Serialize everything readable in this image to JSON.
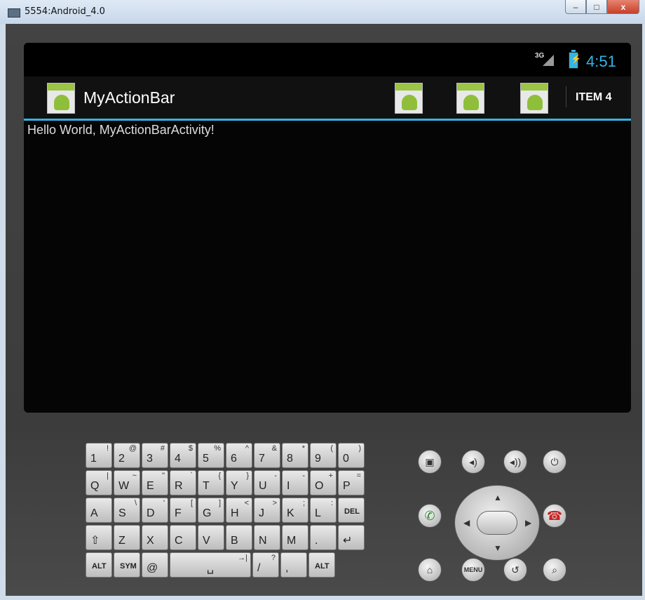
{
  "window": {
    "title": "5554:Android_4.0",
    "min": "–",
    "max": "□",
    "close": "x"
  },
  "status": {
    "network": "3G",
    "time": "4:51",
    "battery_glyph": "⚡"
  },
  "actionbar": {
    "title": "MyActionBar",
    "overflow_item": "ITEM 4"
  },
  "content": {
    "text": "Hello World, MyActionBarActivity!"
  },
  "keyboard": {
    "row1": [
      [
        "1",
        "!"
      ],
      [
        "2",
        "@"
      ],
      [
        "3",
        "#"
      ],
      [
        "4",
        "$"
      ],
      [
        "5",
        "%"
      ],
      [
        "6",
        "^"
      ],
      [
        "7",
        "&"
      ],
      [
        "8",
        "*"
      ],
      [
        "9",
        "("
      ],
      [
        "0",
        ")"
      ]
    ],
    "row2": [
      [
        "Q",
        "|"
      ],
      [
        "W",
        "~"
      ],
      [
        "E",
        "\""
      ],
      [
        "R",
        "`"
      ],
      [
        "T",
        "{"
      ],
      [
        "Y",
        "}"
      ],
      [
        "U",
        "-"
      ],
      [
        "I",
        "-"
      ],
      [
        "O",
        "+"
      ],
      [
        "P",
        "="
      ]
    ],
    "row3": [
      [
        "A",
        ""
      ],
      [
        "S",
        "\\"
      ],
      [
        "D",
        "'"
      ],
      [
        "F",
        "["
      ],
      [
        "G",
        "]"
      ],
      [
        "H",
        "<"
      ],
      [
        "J",
        ">"
      ],
      [
        "K",
        ";"
      ],
      [
        "L",
        ":"
      ],
      [
        "DEL",
        ""
      ]
    ],
    "row4": [
      [
        "⇧",
        ""
      ],
      [
        "Z",
        ""
      ],
      [
        "X",
        ""
      ],
      [
        "C",
        ""
      ],
      [
        "V",
        ""
      ],
      [
        "B",
        ""
      ],
      [
        "N",
        ""
      ],
      [
        "M",
        ""
      ],
      [
        ".",
        ""
      ],
      [
        "↵",
        ""
      ]
    ],
    "row5": [
      [
        "ALT",
        ""
      ],
      [
        "SYM",
        ""
      ],
      [
        "@",
        ""
      ],
      [
        "␣",
        "→|"
      ],
      [
        "/",
        "?"
      ],
      [
        ",",
        ""
      ],
      [
        "ALT",
        ""
      ]
    ]
  },
  "controls": {
    "menu_label": "MENU"
  },
  "colors": {
    "accent": "#33b5e5",
    "screen": "#050505",
    "body": "#3f3f3f"
  }
}
